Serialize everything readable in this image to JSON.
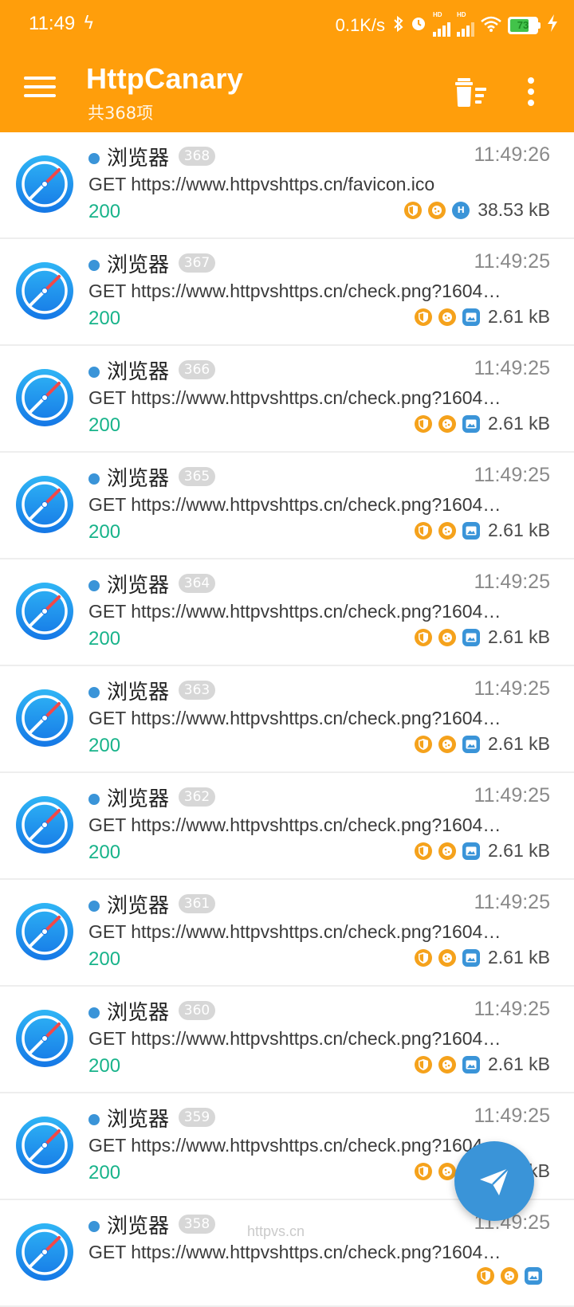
{
  "status_bar": {
    "time": "11:49",
    "net_speed": "0.1K/s",
    "battery": "73",
    "signal_label": "HD"
  },
  "toolbar": {
    "title": "HttpCanary",
    "subtitle": "共368项"
  },
  "requests": [
    {
      "app": "浏览器",
      "count": "368",
      "time": "11:49:26",
      "url": "GET https://www.httpvshttps.cn/favicon.ico",
      "status": "200",
      "size": "38.53 kB",
      "type_icon": "H"
    },
    {
      "app": "浏览器",
      "count": "367",
      "time": "11:49:25",
      "url": "GET https://www.httpvshttps.cn/check.png?1604…",
      "status": "200",
      "size": "2.61 kB",
      "type_icon": "image"
    },
    {
      "app": "浏览器",
      "count": "366",
      "time": "11:49:25",
      "url": "GET https://www.httpvshttps.cn/check.png?1604…",
      "status": "200",
      "size": "2.61 kB",
      "type_icon": "image"
    },
    {
      "app": "浏览器",
      "count": "365",
      "time": "11:49:25",
      "url": "GET https://www.httpvshttps.cn/check.png?1604…",
      "status": "200",
      "size": "2.61 kB",
      "type_icon": "image"
    },
    {
      "app": "浏览器",
      "count": "364",
      "time": "11:49:25",
      "url": "GET https://www.httpvshttps.cn/check.png?1604…",
      "status": "200",
      "size": "2.61 kB",
      "type_icon": "image"
    },
    {
      "app": "浏览器",
      "count": "363",
      "time": "11:49:25",
      "url": "GET https://www.httpvshttps.cn/check.png?1604…",
      "status": "200",
      "size": "2.61 kB",
      "type_icon": "image"
    },
    {
      "app": "浏览器",
      "count": "362",
      "time": "11:49:25",
      "url": "GET https://www.httpvshttps.cn/check.png?1604…",
      "status": "200",
      "size": "2.61 kB",
      "type_icon": "image"
    },
    {
      "app": "浏览器",
      "count": "361",
      "time": "11:49:25",
      "url": "GET https://www.httpvshttps.cn/check.png?1604…",
      "status": "200",
      "size": "2.61 kB",
      "type_icon": "image"
    },
    {
      "app": "浏览器",
      "count": "360",
      "time": "11:49:25",
      "url": "GET https://www.httpvshttps.cn/check.png?1604…",
      "status": "200",
      "size": "2.61 kB",
      "type_icon": "image"
    },
    {
      "app": "浏览器",
      "count": "359",
      "time": "11:49:25",
      "url": "GET https://www.httpvshttps.cn/check.png?1604…",
      "status": "200",
      "size": "2.61 kB",
      "type_icon": "image"
    },
    {
      "app": "浏览器",
      "count": "358",
      "time": "11:49:25",
      "url": "GET https://www.httpvshttps.cn/check.png?1604…",
      "status": "",
      "size": "",
      "type_icon": "image"
    }
  ],
  "watermark": "httpvs.cn",
  "colors": {
    "accent": "#ff9e0b",
    "status_ok": "#18b38a",
    "badge_blue": "#3a94d8",
    "badge_orange": "#f5a21c"
  },
  "icons": {
    "menu": "menu-icon",
    "delete": "delete-sweep-icon",
    "more": "more-vert-icon",
    "fab": "send-icon",
    "app": "compass-icon"
  }
}
